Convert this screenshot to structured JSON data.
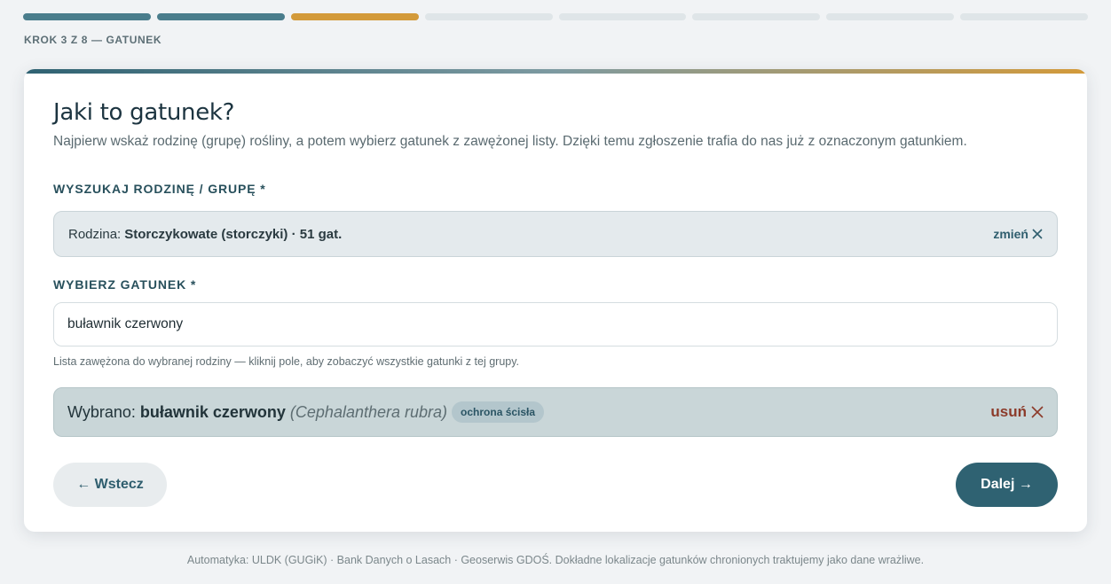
{
  "progress": {
    "total_steps": 8,
    "current_step": 3,
    "step_label": "KROK 3 Z 8 — GATUNEK",
    "colors": {
      "done": "#4a7d8c",
      "current": "#d39a3a",
      "pending": "#dfe5e8"
    }
  },
  "card": {
    "title": "Jaki to gatunek?",
    "subtitle": "Najpierw wskaż rodzinę (grupę) rośliny, a potem wybierz gatunek z zawężonej listy. Dzięki temu zgłoszenie trafia do nas już z oznaczonym gatunkiem."
  },
  "family": {
    "label": "WYSZUKAJ RODZINĘ / GRUPĘ *",
    "prefix": "Rodzina:",
    "value": "Storczykowate (storczyki) · 51 gat.",
    "change_label": "zmień",
    "change_icon": "close-icon"
  },
  "species": {
    "label": "WYBIERZ GATUNEK *",
    "input_value": "buławnik czerwony",
    "hint": "Lista zawężona do wybranej rodziny — kliknij pole, aby zobaczyć wszystkie gatunki z tej grupy."
  },
  "selected": {
    "prefix": "Wybrano:",
    "name": "buławnik czerwony",
    "latin": "(Cephalanthera rubra)",
    "badge": "ochrona ścisła",
    "remove_label": "usuń",
    "remove_icon": "close-icon"
  },
  "nav": {
    "back_label": "← Wstecz",
    "next_label": "Dalej →"
  },
  "footer": {
    "text": "Automatyka: ULDK (GUGiK) · Bank Danych o Lasach · Geoserwis GDOŚ. Dokładne lokalizacje gatunków chronionych traktujemy jako dane wrażliwe."
  }
}
